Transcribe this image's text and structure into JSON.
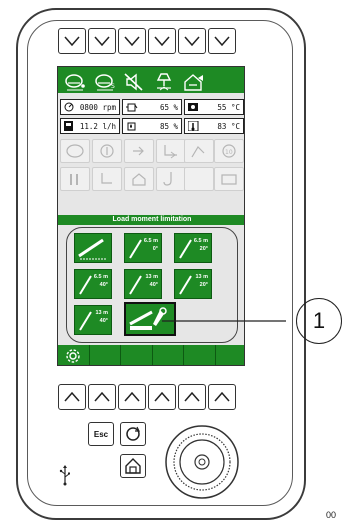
{
  "screen": {
    "status": {
      "engine_rpm": "0800 rpm",
      "fuel_pct": "65 %",
      "coolant_temp": "55 °C",
      "fuel_rate": "11.2 l/h",
      "def_pct": "85 %",
      "oil_temp": "83 °C"
    },
    "section_title": "Load moment limitation",
    "tiles": [
      {
        "line1": "",
        "line2": ""
      },
      {
        "line1": "6.5 m",
        "line2": "0°"
      },
      {
        "line1": "6.5 m",
        "line2": "20°"
      },
      {
        "line1": "6.5 m",
        "line2": "40°"
      },
      {
        "line1": "13 m",
        "line2": "40°"
      },
      {
        "line1": "13 m",
        "line2": "20°"
      },
      {
        "line1": "13 m",
        "line2": "40°"
      }
    ]
  },
  "keypad": {
    "esc_label": "Esc"
  },
  "callout": {
    "label": "1"
  },
  "figure_code": "00"
}
